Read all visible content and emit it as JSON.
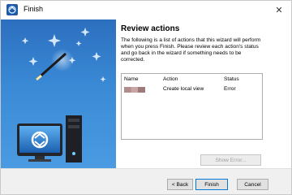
{
  "window": {
    "title": "Finish"
  },
  "page": {
    "heading": "Review actions",
    "description_lines": [
      "The following is a list of actions that this wizard will perform",
      "when you press Finish. Please review each action's status",
      "and go back in the wizard if something needs to be",
      "corrected."
    ]
  },
  "list": {
    "headers": {
      "name": "Name",
      "action": "Action",
      "status": "Status"
    },
    "rows": [
      {
        "name": "",
        "action": "Create local view",
        "status": "Error"
      }
    ]
  },
  "buttons": {
    "show_error": "Show Error...",
    "back": "< Back",
    "finish": "Finish",
    "cancel": "Cancel"
  },
  "icons": {
    "app": "wizard-app-icon",
    "close": "close-icon",
    "banner": "wizard-banner-illustration"
  },
  "colors": {
    "banner_top": "#2c6fbf",
    "banner_bottom": "#4a9be2",
    "accent": "#0078d7"
  }
}
